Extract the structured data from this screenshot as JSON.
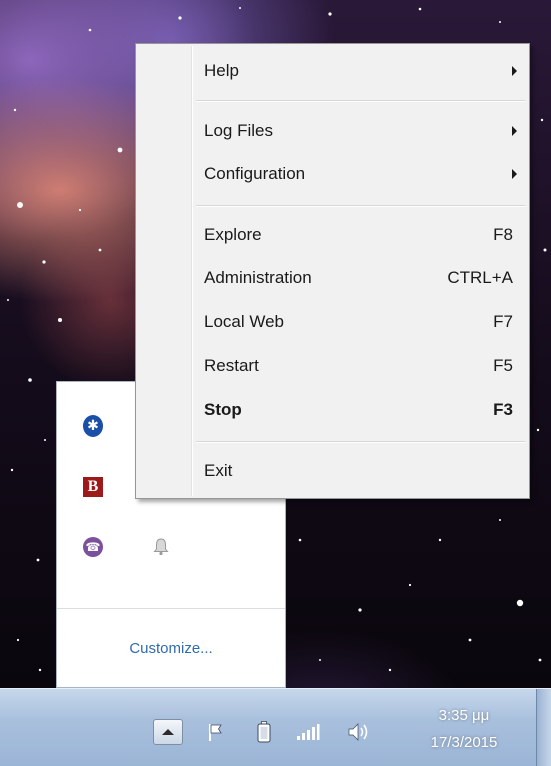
{
  "context_menu": {
    "items": [
      {
        "label": "Help",
        "submenu": true
      },
      {
        "label": "Log Files",
        "submenu": true
      },
      {
        "label": "Configuration",
        "submenu": true
      },
      {
        "label": "Explore",
        "shortcut": "F8"
      },
      {
        "label": "Administration",
        "shortcut": "CTRL+A"
      },
      {
        "label": "Local Web",
        "shortcut": "F7"
      },
      {
        "label": "Restart",
        "shortcut": "F5"
      },
      {
        "label": "Stop",
        "shortcut": "F3",
        "default": true
      },
      {
        "label": "Exit"
      }
    ]
  },
  "tray_overflow": {
    "icons": [
      "bluetooth-icon",
      "b-app-icon",
      "viber-icon",
      "tray-app-icon",
      "window-app-icon",
      "bell-icon"
    ],
    "customize_label": "Customize..."
  },
  "taskbar": {
    "icons": [
      "show-hidden-icons",
      "action-center-flag-icon",
      "battery-icon",
      "network-signal-icon",
      "volume-icon"
    ],
    "clock": {
      "time": "3:35 μμ",
      "date": "17/3/2015"
    }
  },
  "colors": {
    "menu_bg": "#f1f1f1",
    "link": "#2f6bb0",
    "taskbar": "#a9c0dd",
    "bluetooth": "#1a4fa8",
    "viber": "#7b519d",
    "b_app": "#9c1a1a"
  }
}
